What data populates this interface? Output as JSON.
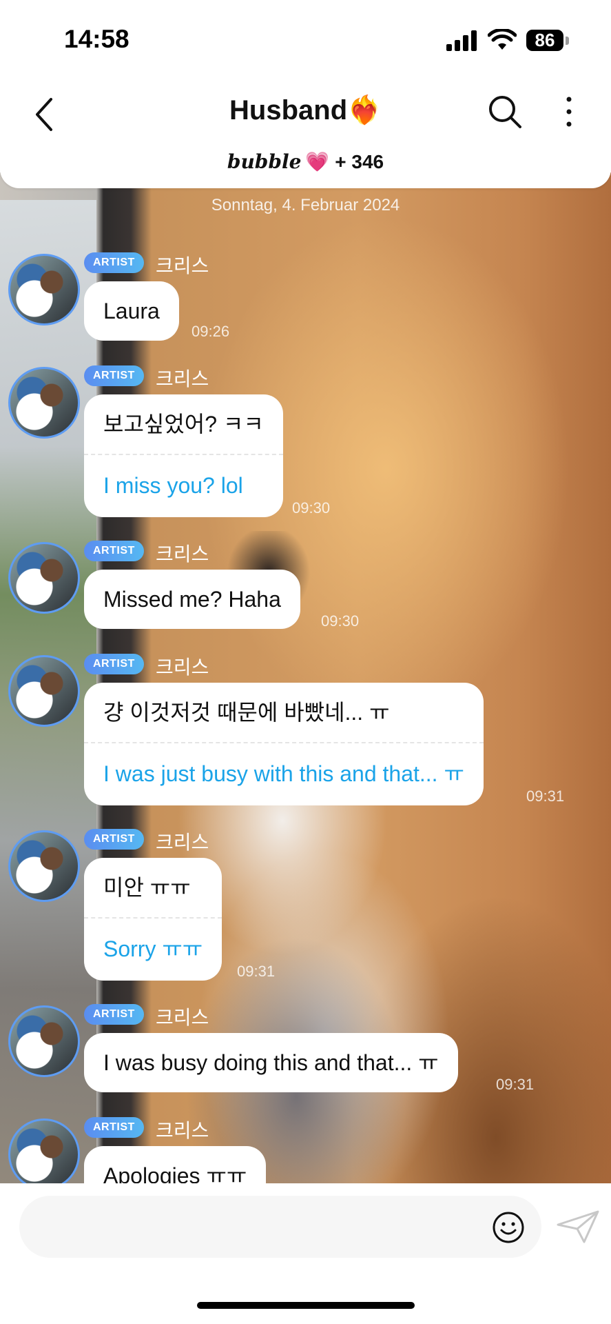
{
  "status_bar": {
    "time": "14:58",
    "battery": "86"
  },
  "header": {
    "title": "Husband❤️‍🔥",
    "brand": "bubble",
    "heart": "💗",
    "count": "+ 346"
  },
  "chat": {
    "date": "Sonntag, 4. Februar 2024",
    "messages": [
      {
        "badge": "ARTIST",
        "sender": "크리스",
        "text": "Laura",
        "translation": "",
        "time": "09:26"
      },
      {
        "badge": "ARTIST",
        "sender": "크리스",
        "text": "보고싶었어? ㅋㅋ",
        "translation": "I miss you? lol",
        "time": "09:30"
      },
      {
        "badge": "ARTIST",
        "sender": "크리스",
        "text": "Missed me? Haha",
        "translation": "",
        "time": "09:30"
      },
      {
        "badge": "ARTIST",
        "sender": "크리스",
        "text": "걍 이것저것 때문에 바빴네... ㅠ",
        "translation": "I was just busy with this and that... ㅠ",
        "time": "09:31"
      },
      {
        "badge": "ARTIST",
        "sender": "크리스",
        "text": "미안 ㅠㅠ",
        "translation": "Sorry ㅠㅠ",
        "time": "09:31"
      },
      {
        "badge": "ARTIST",
        "sender": "크리스",
        "text": "I was busy doing this and that... ㅠ",
        "translation": "",
        "time": "09:31"
      },
      {
        "badge": "ARTIST",
        "sender": "크리스",
        "text": "Apologies ㅠㅠ",
        "translation": "",
        "time": ""
      }
    ]
  },
  "input": {
    "placeholder": ""
  },
  "icons": {
    "back": "chevron-left-icon",
    "search": "search-icon",
    "more": "more-vertical-icon",
    "emoji": "smiley-icon",
    "send": "paper-plane-icon"
  },
  "colors": {
    "accent": "#1aa3e8",
    "badge": "#5a8df0",
    "avatar_ring": "#5e9cf2"
  }
}
